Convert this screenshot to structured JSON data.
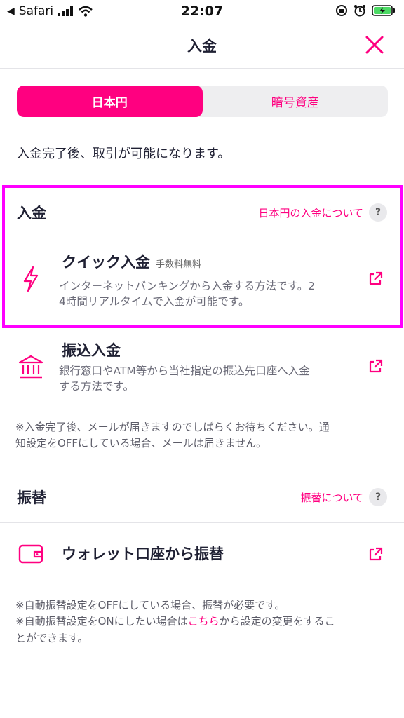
{
  "status_bar": {
    "back_app": "Safari",
    "time": "22:07"
  },
  "nav": {
    "title": "入金",
    "close_icon": "close-icon"
  },
  "tabs": [
    {
      "label": "日本円",
      "active": true
    },
    {
      "label": "暗号資産",
      "active": false
    }
  ],
  "notice": "入金完了後、取引が可能になります。",
  "deposit_section": {
    "title": "入金",
    "help_link": "日本円の入金について",
    "help_mark": "?",
    "methods": [
      {
        "title": "クイック入金",
        "badge": "手数料無料",
        "desc_line1": "インターネットバンキングから入金する方法です。2",
        "desc_line2": "4時間リアルタイムで入金が可能です。",
        "icon": "lightning-icon"
      },
      {
        "title": "振込入金",
        "badge": "",
        "desc_line1": "銀行窓口やATM等から当社指定の振込先口座へ入金",
        "desc_line2": "する方法です。",
        "icon": "bank-icon"
      }
    ],
    "footnote_line1": "※入金完了後、メールが届きますのでしばらくお待ちください。通",
    "footnote_line2": "知設定をOFFにしている場合、メールは届きません。"
  },
  "transfer_section": {
    "title": "振替",
    "help_link": "振替について",
    "help_mark": "?",
    "method_title": "ウォレット口座から振替",
    "method_icon": "wallet-icon",
    "footnote_line1": "※自動振替設定をOFFにしている場合、振替が必要です。",
    "footnote_line2_pre": "※自動振替設定をONにしたい場合は",
    "footnote_line2_link": "こちら",
    "footnote_line2_post": "から設定の変更をするこ",
    "footnote_line3": "とができます。"
  },
  "colors": {
    "accent": "#ff0080",
    "highlight": "#ff00ff",
    "text": "#1f2033"
  }
}
